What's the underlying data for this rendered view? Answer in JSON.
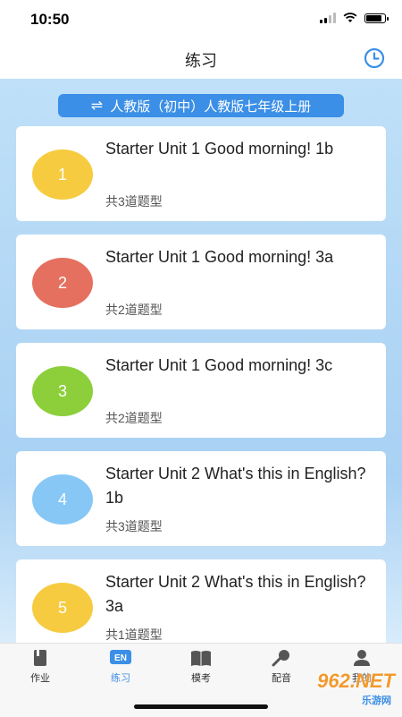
{
  "status_bar": {
    "time": "10:50"
  },
  "nav": {
    "title": "练习"
  },
  "version": {
    "label": "人教版（初中）人教版七年级上册"
  },
  "colors": {
    "accent": "#3b8fe6",
    "badge_yellow": "#f6cb3f",
    "badge_red": "#e5705f",
    "badge_green": "#8ccf3b",
    "badge_blue": "#86c7f6"
  },
  "lessons": [
    {
      "number": "1",
      "title": "Starter Unit 1 Good morning! 1b",
      "count": "共3道题型"
    },
    {
      "number": "2",
      "title": "Starter Unit 1 Good morning! 3a",
      "count": "共2道题型"
    },
    {
      "number": "3",
      "title": "Starter Unit 1 Good morning! 3c",
      "count": "共2道题型"
    },
    {
      "number": "4",
      "title": "Starter Unit 2 What's this in English? 1b",
      "count": "共3道题型"
    },
    {
      "number": "5",
      "title": "Starter Unit 2 What's this in English? 3a",
      "count": "共1道题型"
    }
  ],
  "tabs": [
    {
      "label": "作业",
      "icon": "homework-icon"
    },
    {
      "label": "练习",
      "icon": "en-practice-icon"
    },
    {
      "label": "模考",
      "icon": "book-icon"
    },
    {
      "label": "配音",
      "icon": "microphone-icon"
    },
    {
      "label": "我的",
      "icon": "person-icon"
    }
  ],
  "watermark": {
    "brand": "962.NET",
    "sub": "乐游网"
  }
}
